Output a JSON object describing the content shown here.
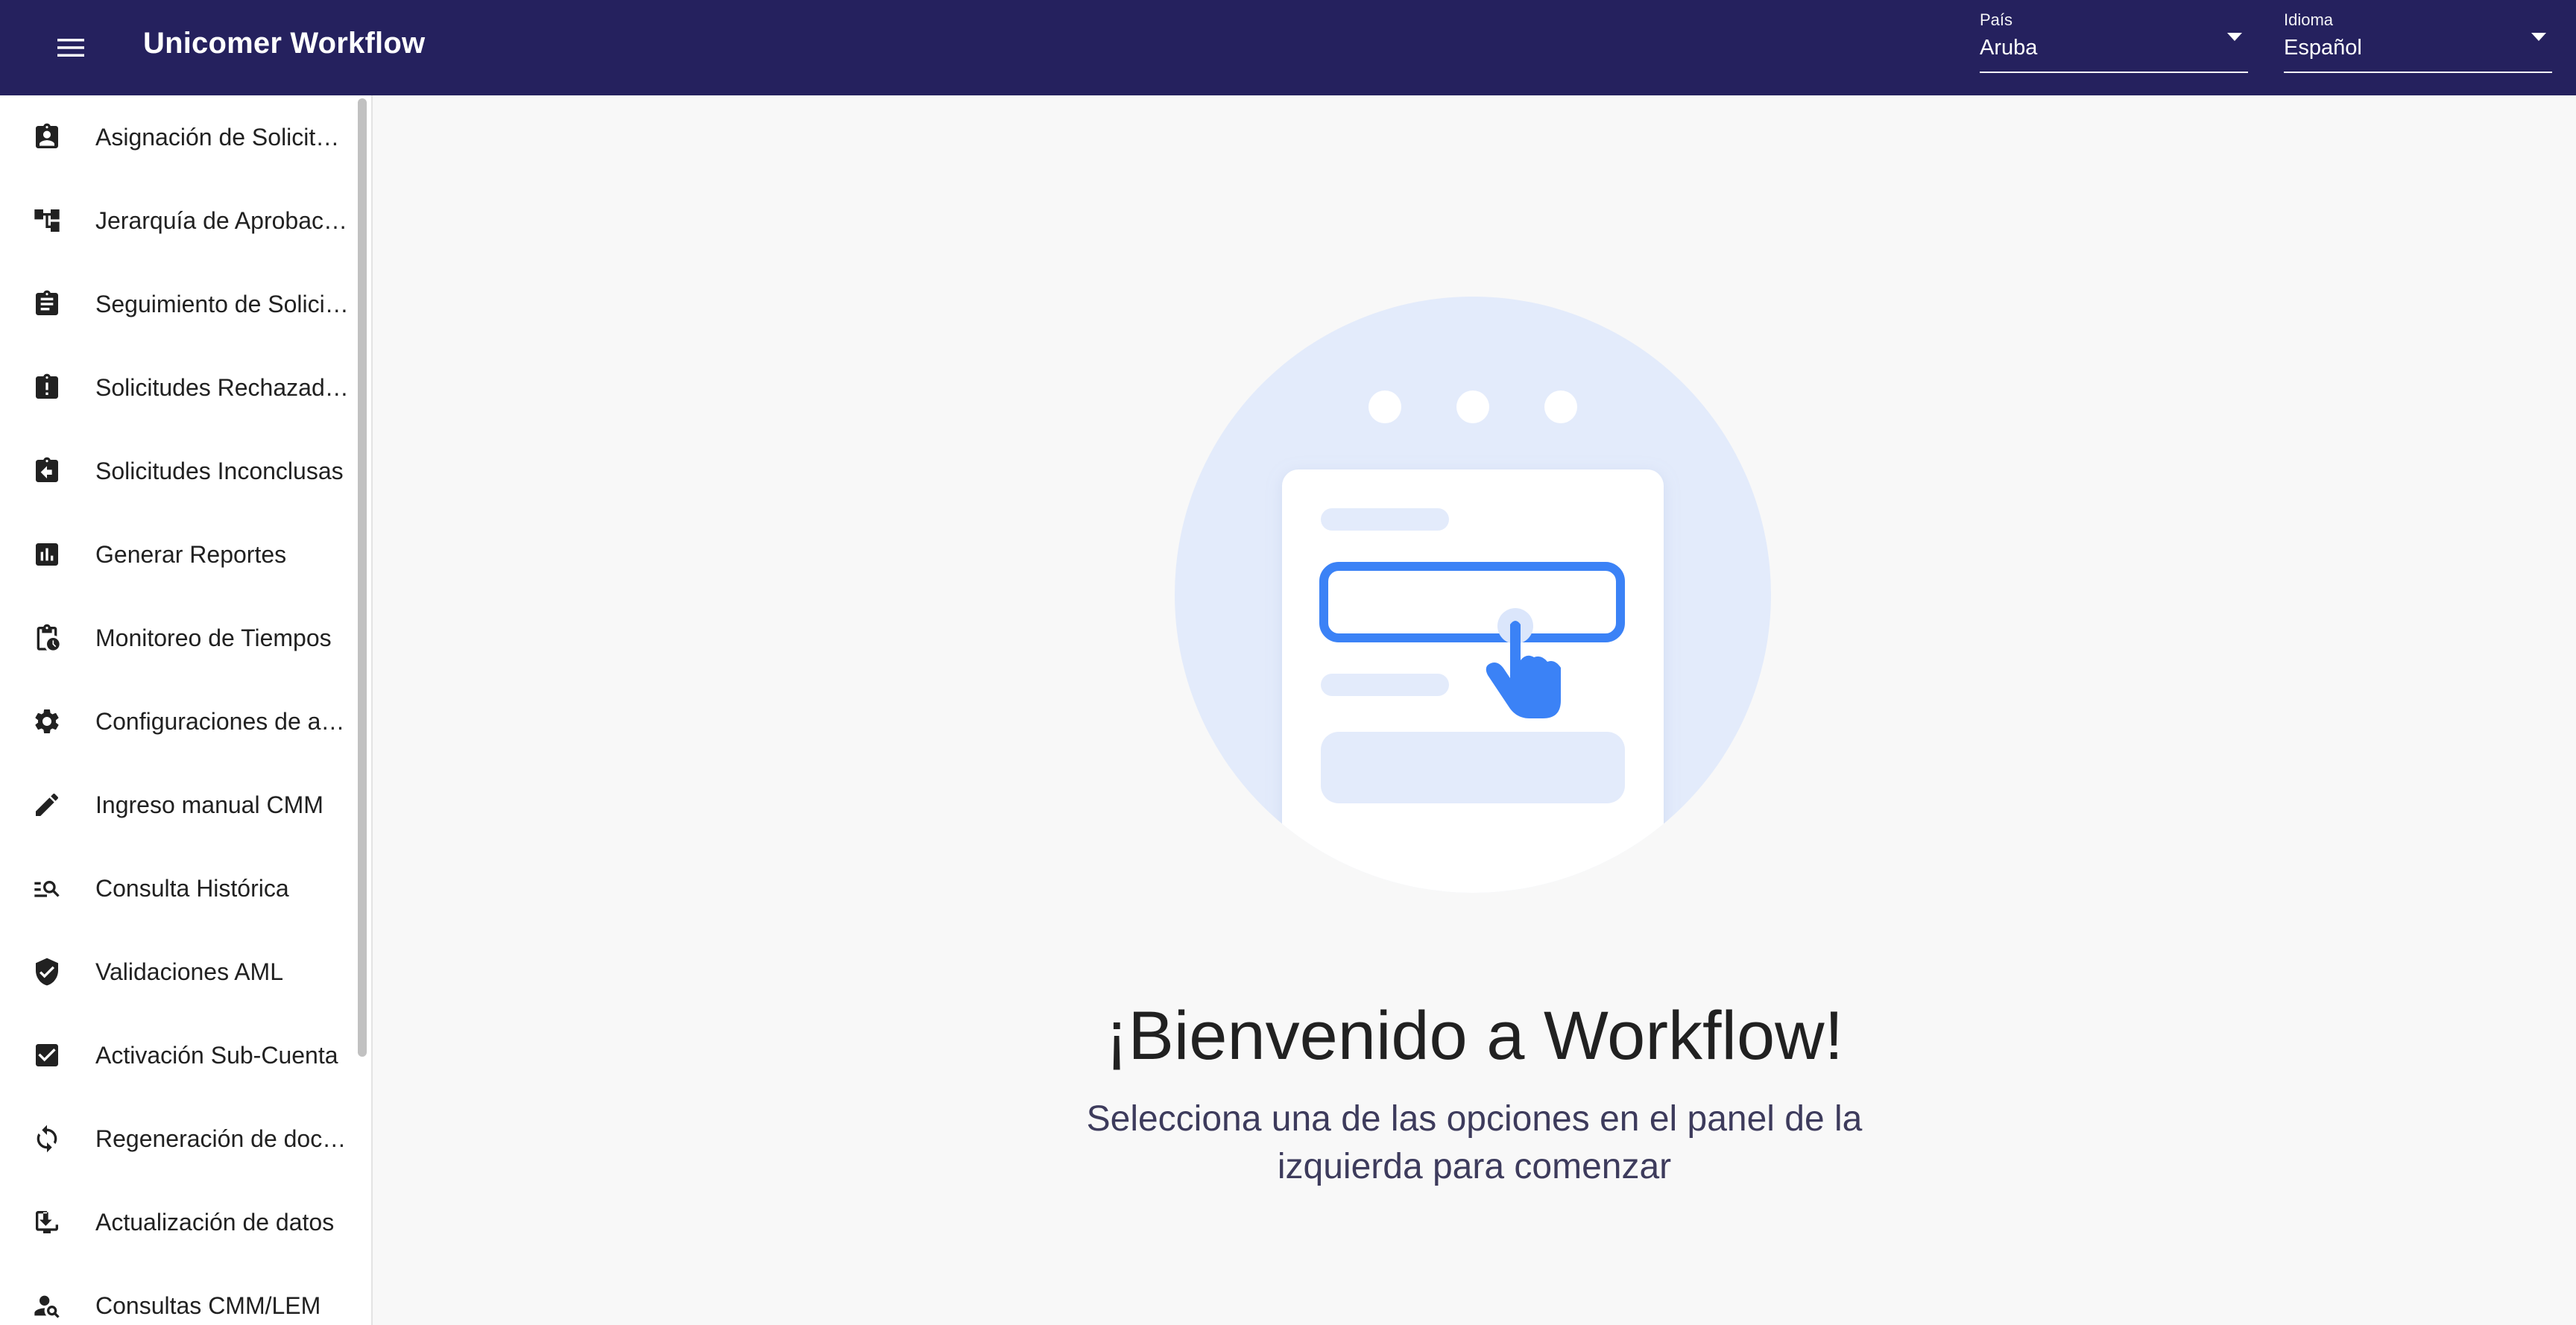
{
  "header": {
    "title": "Unicomer Workflow",
    "menu_icon": "hamburger-menu-icon",
    "country": {
      "label": "País",
      "value": "Aruba"
    },
    "language": {
      "label": "Idioma",
      "value": "Español"
    }
  },
  "sidebar": {
    "items": [
      {
        "label": "Asignación de Solicitudes",
        "icon": "assignment-ind-icon"
      },
      {
        "label": "Jerarquía de Aprobación",
        "icon": "account-tree-icon"
      },
      {
        "label": "Seguimiento de Solicitudes",
        "icon": "assignment-icon"
      },
      {
        "label": "Solicitudes Rechazadas",
        "icon": "assignment-late-icon"
      },
      {
        "label": "Solicitudes Inconclusas",
        "icon": "assignment-return-icon"
      },
      {
        "label": "Generar Reportes",
        "icon": "assessment-icon"
      },
      {
        "label": "Monitoreo de Tiempos",
        "icon": "pending-actions-icon"
      },
      {
        "label": "Configuraciones de asignación",
        "icon": "settings-icon"
      },
      {
        "label": "Ingreso manual CMM",
        "icon": "edit-icon"
      },
      {
        "label": "Consulta Histórica",
        "icon": "manage-search-icon"
      },
      {
        "label": "Validaciones AML",
        "icon": "verified-user-icon"
      },
      {
        "label": "Activación Sub-Cuenta",
        "icon": "check-box-icon"
      },
      {
        "label": "Regeneración de documentos",
        "icon": "sync-icon"
      },
      {
        "label": "Actualización de datos",
        "icon": "install-desktop-icon"
      },
      {
        "label": "Consultas CMM/LEM",
        "icon": "person-search-icon"
      }
    ]
  },
  "main": {
    "title": "¡Bienvenido a Workflow!",
    "subtitle": "Selecciona una de las opciones en el panel de la izquierda para comenzar",
    "illustration_icon": "form-click-illustration"
  },
  "colors": {
    "appbar": "#25215e",
    "accent": "#3b82f6",
    "illustration_bg": "#e3ebfb"
  }
}
